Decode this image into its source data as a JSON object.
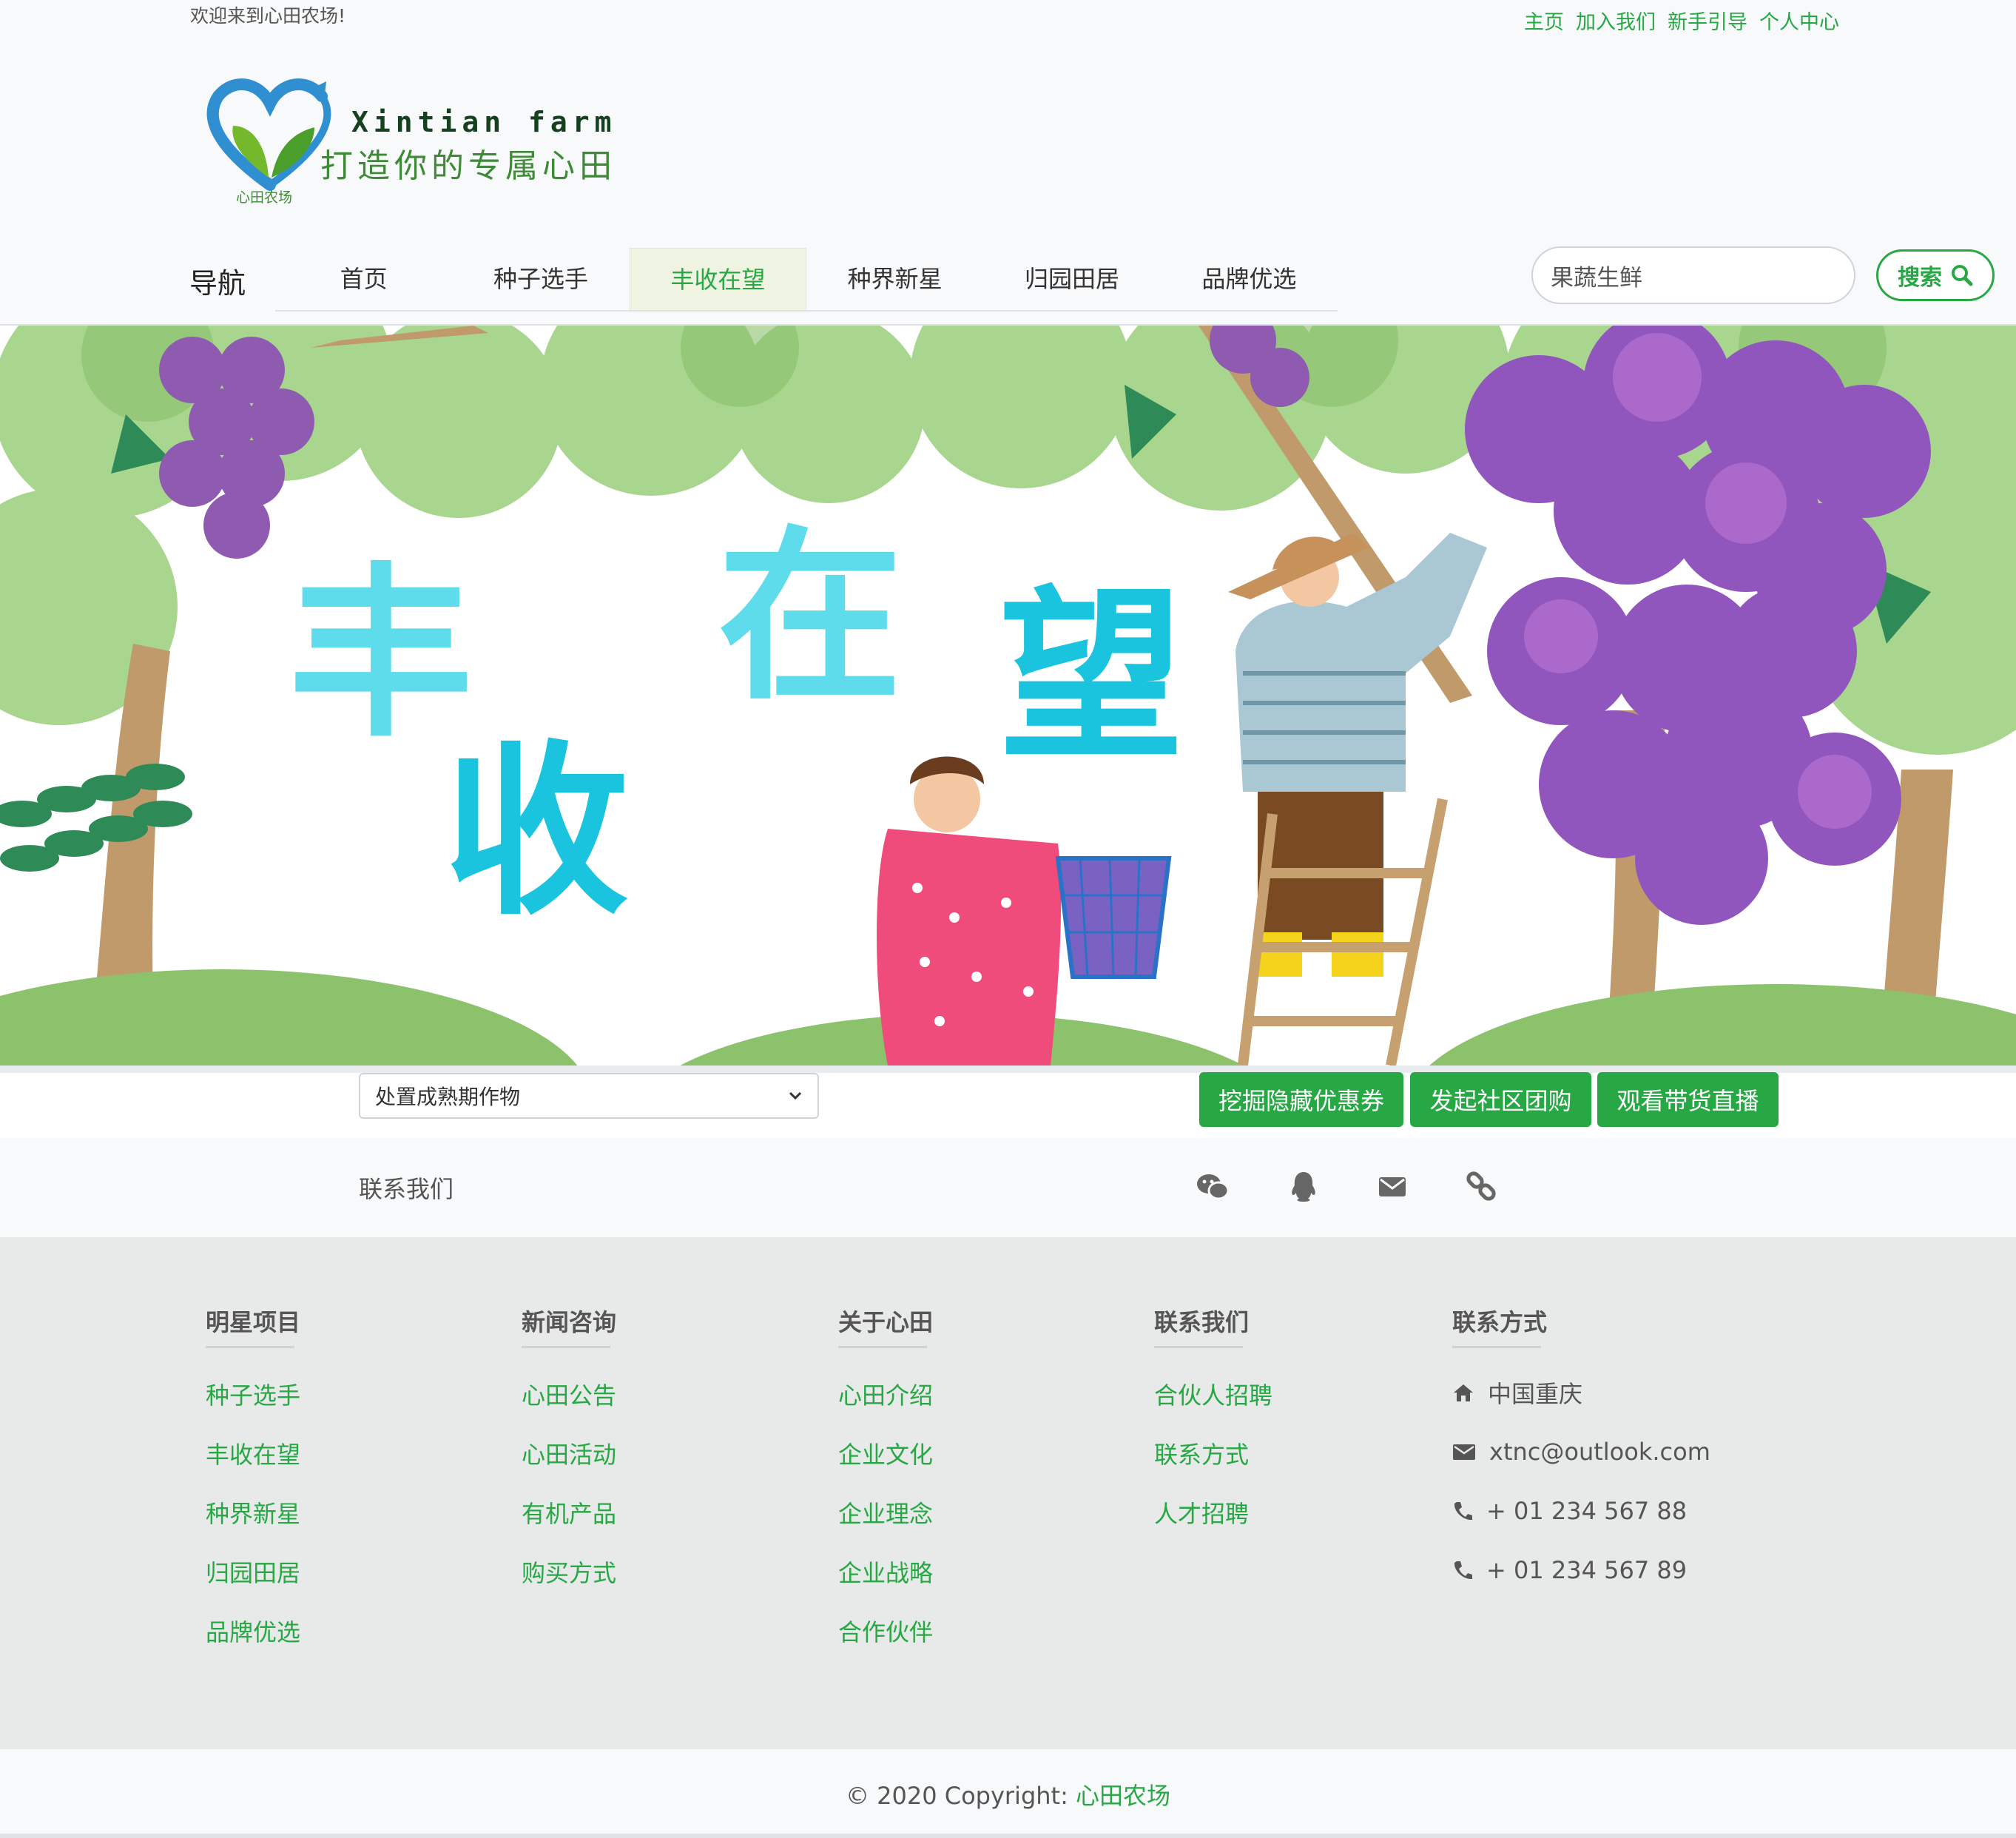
{
  "header": {
    "welcome": "欢迎来到心田农场!",
    "top_links": [
      "主页",
      "加入我们",
      "新手引导",
      "个人中心"
    ]
  },
  "logo": {
    "name_en": "Xintian farm",
    "slogan": "打造你的专属心田",
    "name_cn": "心田农场"
  },
  "nav": {
    "title": "导航",
    "items": [
      {
        "label": "首页",
        "active": false
      },
      {
        "label": "种子选手",
        "active": false
      },
      {
        "label": "丰收在望",
        "active": true
      },
      {
        "label": "种界新星",
        "active": false
      },
      {
        "label": "归园田居",
        "active": false
      },
      {
        "label": "品牌优选",
        "active": false
      }
    ]
  },
  "search": {
    "value": "果蔬生鲜",
    "button_label": "搜索",
    "icon": "search-icon"
  },
  "banner": {
    "title_chars": [
      "丰",
      "收",
      "在",
      "望"
    ]
  },
  "actions": {
    "select_value": "处置成熟期作物",
    "buttons": [
      "挖掘隐藏优惠券",
      "发起社区团购",
      "观看带货直播"
    ]
  },
  "contact": {
    "label": "联系我们",
    "icons": [
      "wechat-icon",
      "qq-icon",
      "envelope-icon",
      "link-icon"
    ]
  },
  "footer": {
    "columns": [
      {
        "title": "明星项目",
        "links": [
          "种子选手",
          "丰收在望",
          "种界新星",
          "归园田居",
          "品牌优选"
        ]
      },
      {
        "title": "新闻咨询",
        "links": [
          "心田公告",
          "心田活动",
          "有机产品",
          "购买方式"
        ]
      },
      {
        "title": "关于心田",
        "links": [
          "心田介绍",
          "企业文化",
          "企业理念",
          "企业战略",
          "合作伙伴"
        ]
      },
      {
        "title": "联系我们",
        "links": [
          "合伙人招聘",
          "联系方式",
          "人才招聘"
        ]
      }
    ],
    "contact_info": {
      "title": "联系方式",
      "items": [
        {
          "icon": "home-icon",
          "text": "中国重庆"
        },
        {
          "icon": "envelope-icon",
          "text": "xtnc@outlook.com"
        },
        {
          "icon": "phone-icon",
          "text": "+ 01 234 567 88"
        },
        {
          "icon": "phone-icon",
          "text": "+ 01 234 567 89"
        }
      ]
    }
  },
  "copyright": {
    "prefix": "© 2020 Copyright: ",
    "brand": "心田农场"
  },
  "colors": {
    "accent": "#28a745",
    "banner_title": "#5bd6ea",
    "footer_bg": "#e7eae8"
  }
}
